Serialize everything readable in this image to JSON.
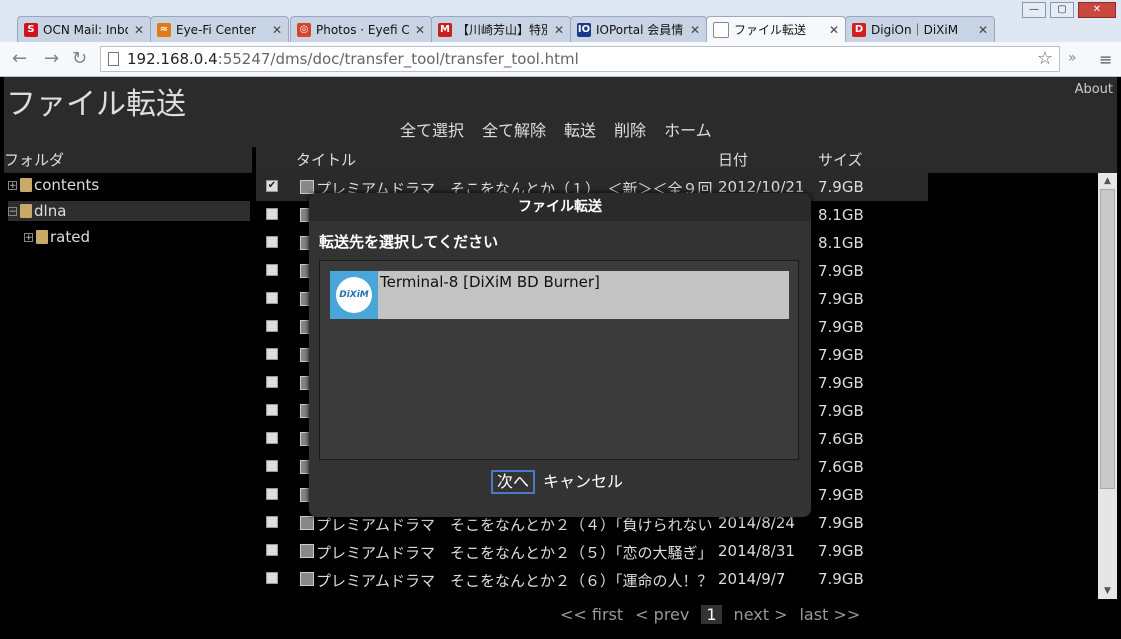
{
  "browser": {
    "tabs": [
      {
        "label": "OCN Mail: Inbo",
        "icon": "ocn-favicon",
        "color": "#d0121b",
        "glyph": "S"
      },
      {
        "label": "Eye-Fi Center",
        "icon": "eyefi-favicon",
        "color": "#e07a16",
        "glyph": "≈"
      },
      {
        "label": "Photos · Eyefi C",
        "icon": "photos-favicon",
        "color": "#d3462c",
        "glyph": "◎"
      },
      {
        "label": "【川崎芳山】特別",
        "icon": "gmail-favicon",
        "color": "#c5221f",
        "glyph": "M"
      },
      {
        "label": "IOPortal 会員情",
        "icon": "ioportal-favicon",
        "color": "#1a3a8a",
        "glyph": "IO"
      },
      {
        "label": "ファイル転送",
        "icon": "page-favicon",
        "color": "#ffffff",
        "glyph": ""
      },
      {
        "label": "DigiOn｜DiXiM",
        "icon": "digion-favicon",
        "color": "#d21f1f",
        "glyph": "D"
      }
    ],
    "url_host": "192.168.0.4",
    "url_rest": ":55247/dms/doc/transfer_tool/transfer_tool.html"
  },
  "app": {
    "title": "ファイル転送",
    "about": "About",
    "menu": [
      "全て選択",
      "全て解除",
      "転送",
      "削除",
      "ホーム"
    ],
    "folder_header": "フォルダ",
    "tree": [
      {
        "label": "contents",
        "expander": "+",
        "selected": false
      },
      {
        "label": "dlna",
        "expander": "−",
        "selected": true
      },
      {
        "label": "rated",
        "expander": "+",
        "selected": false
      }
    ],
    "columns": {
      "title": "タイトル",
      "date": "日付",
      "size": "サイズ"
    },
    "rows": [
      {
        "title": "プレミアムドラマ　そこをなんとか（１）　＜新＞＜全９回",
        "date": "2012/10/21",
        "size": "7.9GB",
        "checked": true
      },
      {
        "title": "",
        "date": "",
        "size": "8.1GB",
        "checked": false
      },
      {
        "title": "",
        "date": "",
        "size": "8.1GB",
        "checked": false
      },
      {
        "title": "",
        "date": "",
        "size": "7.9GB",
        "checked": false
      },
      {
        "title": "",
        "date": "",
        "size": "7.9GB",
        "checked": false
      },
      {
        "title": "",
        "date": "",
        "size": "7.9GB",
        "checked": false
      },
      {
        "title": "",
        "date": "",
        "size": "7.9GB",
        "checked": false
      },
      {
        "title": "",
        "date": "",
        "size": "7.9GB",
        "checked": false
      },
      {
        "title": "",
        "date": "",
        "size": "7.9GB",
        "checked": false
      },
      {
        "title": "",
        "date": "",
        "size": "7.6GB",
        "checked": false
      },
      {
        "title": "",
        "date": "",
        "size": "7.6GB",
        "checked": false
      },
      {
        "title": "",
        "date": "",
        "size": "7.9GB",
        "checked": false
      },
      {
        "title": "プレミアムドラマ　そこをなんとか２（４）「負けられない",
        "date": "2014/8/24",
        "size": "7.9GB",
        "checked": false
      },
      {
        "title": "プレミアムドラマ　そこをなんとか２（５）「恋の大騒ぎ」",
        "date": "2014/8/31",
        "size": "7.9GB",
        "checked": false
      },
      {
        "title": "プレミアムドラマ　そこをなんとか２（６）「運命の人！？",
        "date": "2014/9/7",
        "size": "7.9GB",
        "checked": false
      }
    ],
    "pager": {
      "first": "<< first",
      "prev": "< prev",
      "current": "1",
      "next": "next >",
      "last": "last >>"
    }
  },
  "dialog": {
    "title": "ファイル転送",
    "prompt": "転送先を選択してください",
    "destination": {
      "label": "Terminal-8 [DiXiM BD Burner]",
      "icon_text": "DiXiM"
    },
    "next_label": "次へ",
    "cancel_label": "キャンセル"
  }
}
